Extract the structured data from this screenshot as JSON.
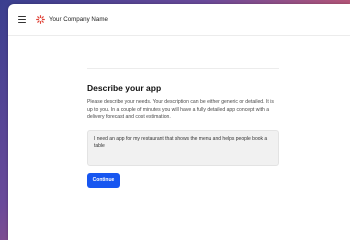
{
  "header": {
    "company_name": "Your Company Name",
    "menu_icon": "hamburger-menu-icon",
    "logo_icon": "company-logo-icon",
    "logo_color": "#e0453a"
  },
  "form": {
    "title": "Describe your app",
    "description": "Please describe your needs. Your description can be either generic or detailed. It is up to you. In a couple of minutes you will have a fully detailed app concept with a delivery forecast and cost estimation.",
    "textarea_value": "I need an app for my restaurant that shows the menu and helps people book a table",
    "continue_label": "Continue",
    "accent_color": "#1756f0"
  }
}
